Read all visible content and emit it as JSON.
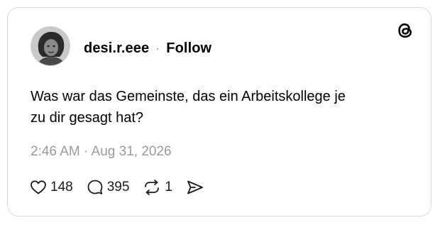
{
  "post": {
    "author": {
      "username": "desi.r.eee",
      "follow_label": "Follow",
      "separator": "·"
    },
    "brand_icon": "threads-logo-icon",
    "text_lines": [
      "Was war das Gemeinste, das ein Arbeitskollege je",
      "zu dir gesagt hat?"
    ],
    "timestamp": "2:46 AM · Aug 31, 2026",
    "stats": {
      "likes": "148",
      "replies": "395",
      "reposts": "1"
    },
    "icons": {
      "like": "heart-icon",
      "reply": "comment-bubble-icon",
      "repost": "repost-icon",
      "share": "send-icon"
    }
  }
}
